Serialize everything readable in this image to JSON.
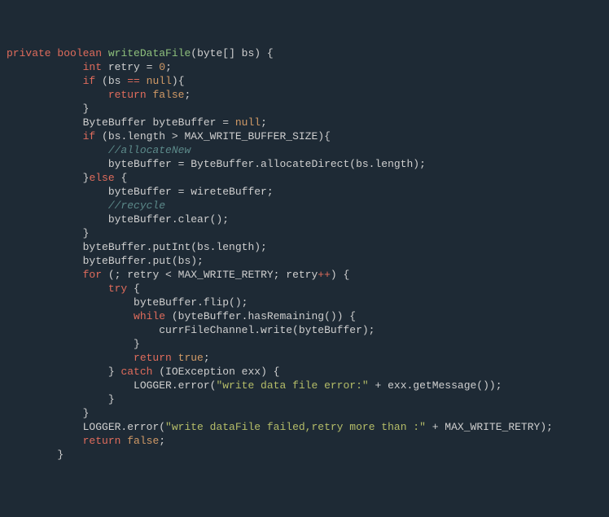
{
  "code": {
    "line1": {
      "kw1": "private",
      "kw2": "boolean",
      "fn": "writeDataFile",
      "rest": "(byte[] bs) {"
    },
    "line2": {
      "kwint": "int",
      "txt1": " retry = ",
      "num": "0",
      "txt2": ";"
    },
    "line3": {
      "kwif": "if",
      "txt1": " (bs ",
      "eq": "==",
      "txt2": " ",
      "null": "null",
      "txt3": "){"
    },
    "line4": {
      "kwret": "return",
      "txt1": " ",
      "false": "false",
      "txt2": ";"
    },
    "line5": {
      "brace": "}"
    },
    "line6": {
      "txt": "ByteBuffer byteBuffer = ",
      "null": "null",
      "semi": ";"
    },
    "line7": {
      "kwif": "if",
      "txt": " (bs.length > MAX_WRITE_BUFFER_SIZE){"
    },
    "line8": {
      "com": "//allocateNew"
    },
    "line9": {
      "txt": "byteBuffer = ByteBuffer.allocateDirect(bs.length);"
    },
    "line10": {
      "brace": "}",
      "kwelse": "else",
      "txt": " {"
    },
    "line11": {
      "txt": "byteBuffer = wireteBuffer;"
    },
    "line12": {
      "com": "//recycle"
    },
    "line13": {
      "txt": "byteBuffer.clear();"
    },
    "line14": {
      "brace": "}"
    },
    "line15": {
      "txt": "byteBuffer.putInt(bs.length);"
    },
    "line16": {
      "txt": "byteBuffer.put(bs);"
    },
    "line17": {
      "kwfor": "for",
      "txt1": " (; retry < MAX_WRITE_RETRY; retry",
      "inc": "++",
      "txt2": ") {"
    },
    "line18": {
      "kwtry": "try",
      "txt": " {"
    },
    "line19": {
      "txt": "byteBuffer.flip();"
    },
    "line20": {
      "kwwhile": "while",
      "txt": " (byteBuffer.hasRemaining()) {"
    },
    "line21": {
      "txt": "currFileChannel.write(byteBuffer);"
    },
    "line22": {
      "brace": "}"
    },
    "line23": {
      "kwret": "return",
      "txt1": " ",
      "true": "true",
      "txt2": ";"
    },
    "line24": {
      "brace": "} ",
      "kwcatch": "catch",
      "txt": " (IOException exx) {"
    },
    "line25": {
      "txt1": "LOGGER.error(",
      "str": "\"write data file error:\"",
      "txt2": " + exx.getMessage());"
    },
    "line26": {
      "brace": "}"
    },
    "line27": {
      "brace": "}"
    },
    "line28": {
      "txt1": "LOGGER.error(",
      "str": "\"write dataFile failed,retry more than :\"",
      "txt2": " + MAX_WRITE_RETRY);"
    },
    "line29": {
      "kwret": "return",
      "txt1": " ",
      "false": "false",
      "txt2": ";"
    },
    "line30": {
      "brace": "}"
    }
  }
}
